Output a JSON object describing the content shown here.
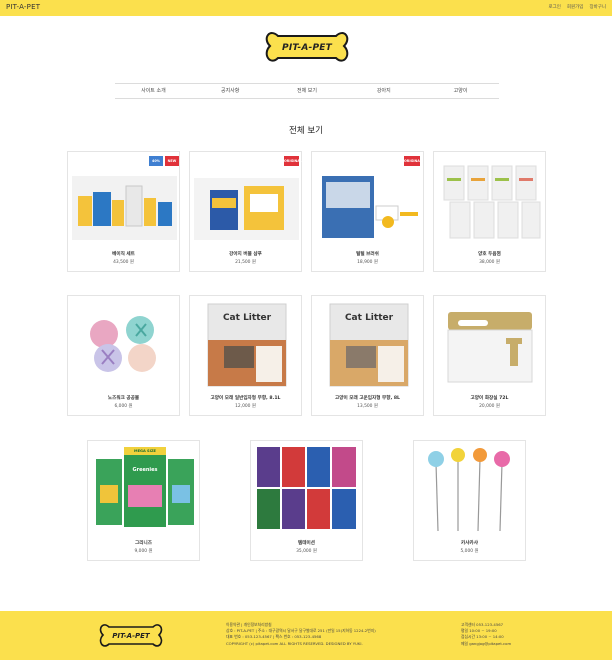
{
  "header": {
    "brand": "PIT-A-PET",
    "links": [
      "로그인",
      "회원가입",
      "장바구니"
    ]
  },
  "logo": {
    "text": "PIT-A-PET"
  },
  "nav": {
    "items": [
      "사이트 소개",
      "공지사항",
      "전체 보기",
      "강아지",
      "고양이"
    ]
  },
  "section": {
    "title": "전체 보기"
  },
  "products": [
    {
      "name": "베이직 세트",
      "price": "43,500 원",
      "badges": [
        "40% SALE",
        "NEW"
      ]
    },
    {
      "name": "강아지 버블 샴푸",
      "price": "21,500 원",
      "badges": [
        "ORIGINAL"
      ]
    },
    {
      "name": "털털 브러쉬",
      "price": "18,900 원",
      "badges": [
        "ORIGINAL"
      ]
    },
    {
      "name": "양호 두음껌",
      "price": "38,000 원",
      "badges": []
    },
    {
      "name": "노즈워크 공공볼",
      "price": "6,000 원",
      "badges": []
    },
    {
      "name": "고양이 모래 일반입자형 무향, 8.1L",
      "price": "12,000 원",
      "badges": []
    },
    {
      "name": "고양이 모래 고운입자형 무향, 8L",
      "price": "13,500 원",
      "badges": []
    },
    {
      "name": "고양이 화장실 72L",
      "price": "20,000 원",
      "badges": []
    },
    {
      "name": "그리니즈",
      "price": "9,000 원",
      "badges": []
    },
    {
      "name": "템테이션",
      "price": "35,000 원",
      "badges": []
    },
    {
      "name": "카샤카샤",
      "price": "5,000 원",
      "badges": []
    }
  ],
  "product_labels": {
    "cat_litter": "Cat Litter",
    "mega_size": "MEGA SIZE",
    "greenies": "Greenies",
    "temptations": "Temptations",
    "shower": "RELAX SHOWER",
    "itchu": "it chu"
  },
  "footer": {
    "logo_text": "PIT-A-PET",
    "info_lines": [
      "이용약관 | 개인정보처리방침",
      "상호 : PIT-A-PET | 주소 : 대구광역시 달서구 달구벌대로 251 (만일 15)지하동 1224-2번지)",
      "대표 번호 : 053-123-4567 | 팩스 번호 : 053-123-4568",
      "COPYRIGHT (c) pitapet.com ALL RIGHTS RESERVED. DESIGNED BY YUKI."
    ],
    "contact_lines": [
      "고객센터 053-123-4567",
      "평일 10:00 ~ 19:00",
      "점심시간 13:00 ~ 14:00",
      "메일 gangjog@pitapet.com"
    ]
  },
  "colors": {
    "accent": "#fbe04d"
  }
}
